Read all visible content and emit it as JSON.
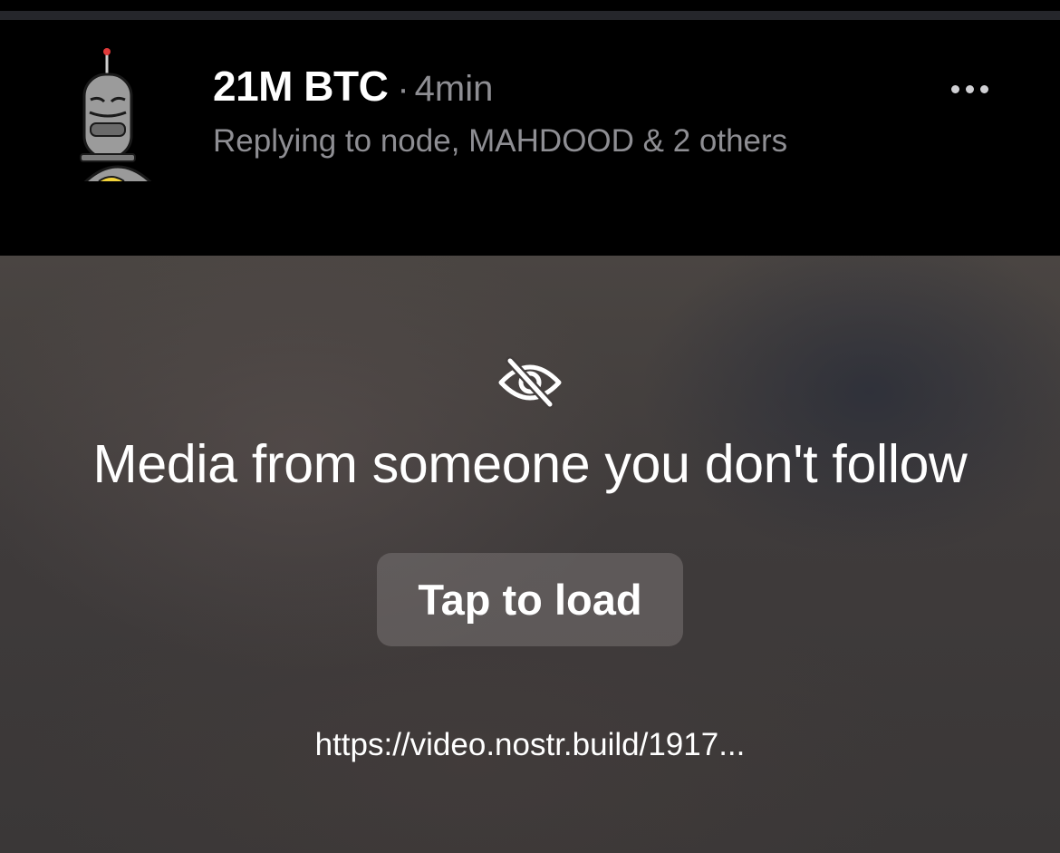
{
  "post": {
    "author_name": "21M BTC",
    "separator": "·",
    "time": "4min",
    "reply_text": "Replying to node, MAHDOOD & 2 others",
    "avatar_icon": "robot-avatar-icon",
    "more_icon": "ellipsis-icon"
  },
  "media": {
    "hidden_icon": "eye-slash-icon",
    "message": "Media from someone you don't follow",
    "button_label": "Tap to load",
    "url": "https://video.nostr.build/1917..."
  },
  "colors": {
    "background": "#000000",
    "divider": "#25262b",
    "primary_text": "#ffffff",
    "secondary_text": "#8e8e93",
    "media_overlay": "#433e3d"
  }
}
